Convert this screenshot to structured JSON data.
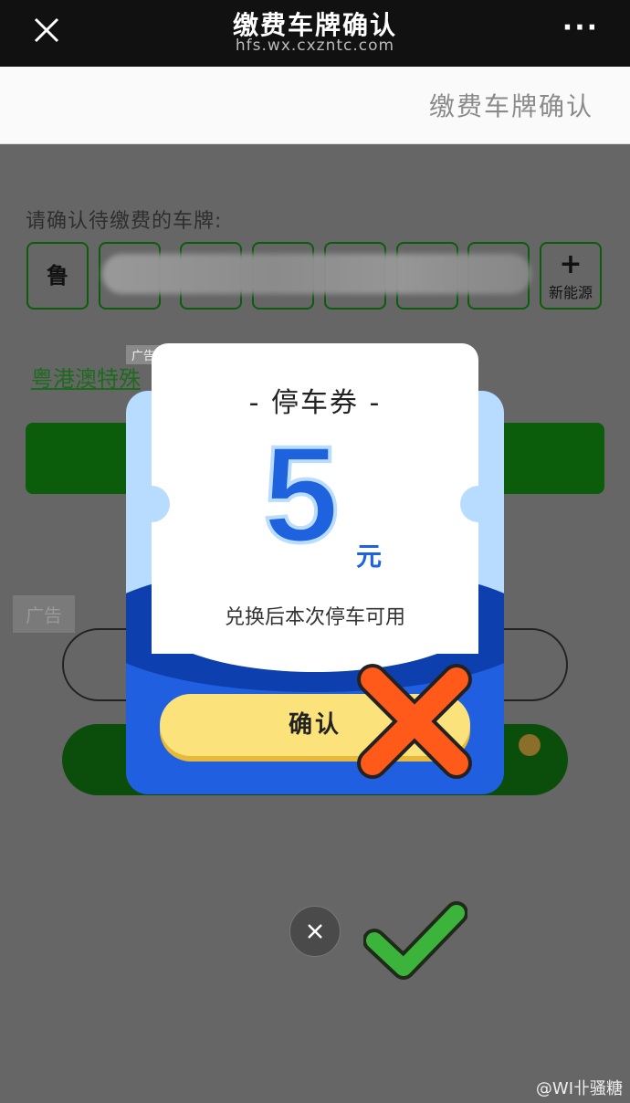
{
  "topbar": {
    "title": "缴费车牌确认",
    "url": "hfs.wx.cxzntc.com",
    "more_icon": "more-dots-icon",
    "close_icon": "close-icon"
  },
  "header": {
    "title": "缴费车牌确认"
  },
  "plate": {
    "prompt": "请确认待缴费的车牌:",
    "first_char": "鲁",
    "new_energy_label": "新能源",
    "new_energy_plus": "+"
  },
  "ads": {
    "tag_small": "广告",
    "link_text": "粤港澳特殊",
    "tag_large": "广告"
  },
  "coupon": {
    "title": "- 停车券 -",
    "amount": "5",
    "unit": "元",
    "description": "兑换后本次停车可用",
    "confirm_label": "确认"
  },
  "dismiss_icon": "close-icon",
  "watermark": "@WI卝骚糖"
}
